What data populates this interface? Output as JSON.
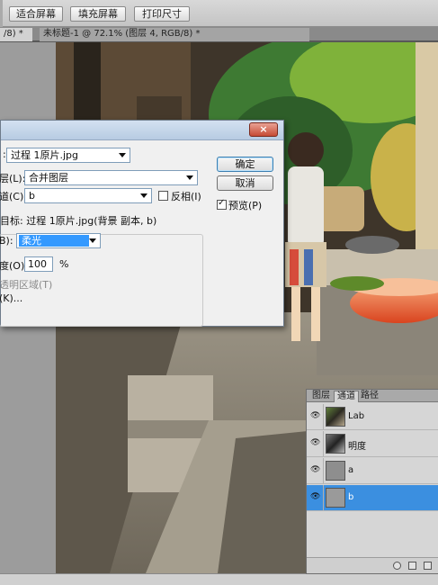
{
  "options_bar": {
    "buttons": [
      "适合屏幕",
      "填充屏幕",
      "打印尺寸"
    ]
  },
  "tabs": [
    {
      "label": "/8) *",
      "close": "×"
    },
    {
      "label": "未标题-1 @ 72.1% (图层 4, RGB/8) *",
      "close": "×"
    }
  ],
  "dialog": {
    "close_label": "×",
    "source_label": ":",
    "source_value": "过程  1原片.jpg",
    "layer_label": "层(L):",
    "layer_value": "合并图层",
    "channel_label": "道(C):",
    "channel_value": "b",
    "invert_label": "反相(I)",
    "invert_checked": false,
    "target_text": "目标: 过程  1原片.jpg(背景 副本, b)",
    "blend_label": "B):",
    "blend_value": "柔光",
    "opacity_label": "度(O):",
    "opacity_value": "100",
    "opacity_unit": "%",
    "preserve_label": "透明区域(T)",
    "mask_label": "(K)...",
    "ok_label": "确定",
    "cancel_label": "取消",
    "preview_label": "预览(P)",
    "preview_checked": true
  },
  "panel": {
    "tabs": [
      "图层",
      "通道",
      "路径"
    ],
    "active_tab": "通道",
    "channels": [
      {
        "name": "Lab",
        "active": false
      },
      {
        "name": "明度",
        "active": false
      },
      {
        "name": "a",
        "active": false
      },
      {
        "name": "b",
        "active": true
      }
    ],
    "accent": "#3b8fe0"
  }
}
